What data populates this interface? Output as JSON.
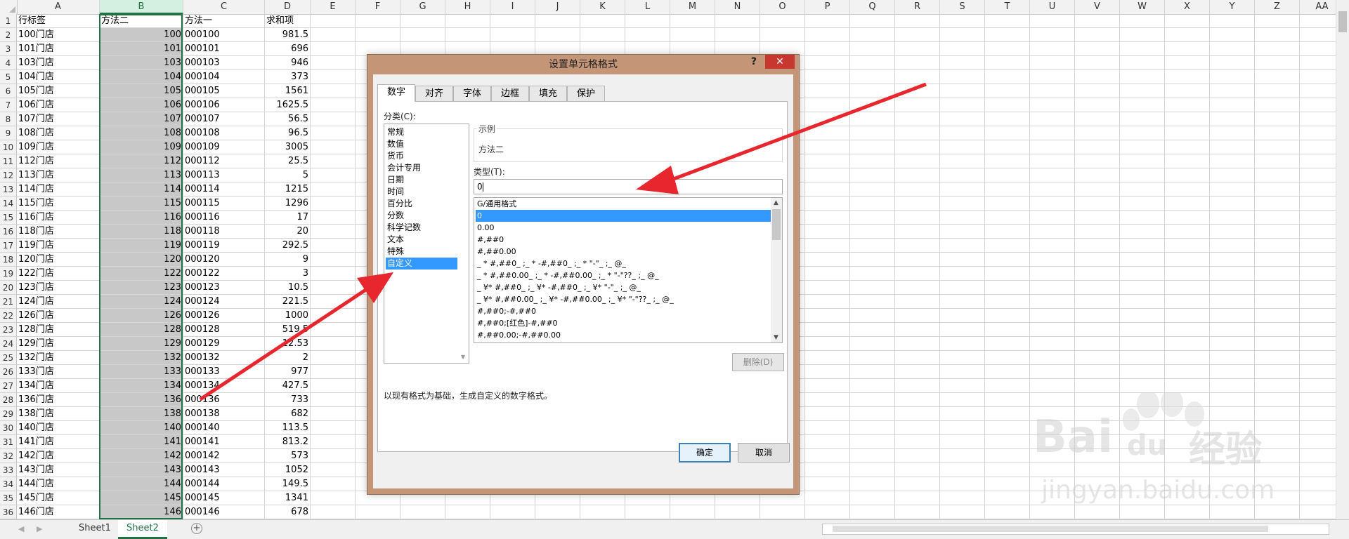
{
  "columns": [
    "A",
    "B",
    "C",
    "D",
    "E",
    "F",
    "G",
    "H",
    "I",
    "J",
    "K",
    "L",
    "M",
    "N",
    "O",
    "P",
    "Q",
    "R",
    "S",
    "T",
    "U",
    "V",
    "W",
    "X",
    "Y",
    "Z",
    "AA"
  ],
  "header_row": [
    "行标签",
    "方法二",
    "方法一",
    "求和项"
  ],
  "rows": [
    [
      "100门店",
      "100",
      "000100",
      "981.5"
    ],
    [
      "101门店",
      "101",
      "000101",
      "696"
    ],
    [
      "103门店",
      "103",
      "000103",
      "946"
    ],
    [
      "104门店",
      "104",
      "000104",
      "373"
    ],
    [
      "105门店",
      "105",
      "000105",
      "1561"
    ],
    [
      "106门店",
      "106",
      "000106",
      "1625.5"
    ],
    [
      "107门店",
      "107",
      "000107",
      "56.5"
    ],
    [
      "108门店",
      "108",
      "000108",
      "96.5"
    ],
    [
      "109门店",
      "109",
      "000109",
      "3005"
    ],
    [
      "112门店",
      "112",
      "000112",
      "25.5"
    ],
    [
      "113门店",
      "113",
      "000113",
      "5"
    ],
    [
      "114门店",
      "114",
      "000114",
      "1215"
    ],
    [
      "115门店",
      "115",
      "000115",
      "1296"
    ],
    [
      "116门店",
      "116",
      "000116",
      "17"
    ],
    [
      "118门店",
      "118",
      "000118",
      "20"
    ],
    [
      "119门店",
      "119",
      "000119",
      "292.5"
    ],
    [
      "120门店",
      "120",
      "000120",
      "9"
    ],
    [
      "122门店",
      "122",
      "000122",
      "3"
    ],
    [
      "123门店",
      "123",
      "000123",
      "10.5"
    ],
    [
      "124门店",
      "124",
      "000124",
      "221.5"
    ],
    [
      "126门店",
      "126",
      "000126",
      "1000"
    ],
    [
      "128门店",
      "128",
      "000128",
      "519.5"
    ],
    [
      "129门店",
      "129",
      "000129",
      "12.53"
    ],
    [
      "132门店",
      "132",
      "000132",
      "2"
    ],
    [
      "133门店",
      "133",
      "000133",
      "977"
    ],
    [
      "134门店",
      "134",
      "000134",
      "427.5"
    ],
    [
      "136门店",
      "136",
      "000136",
      "733"
    ],
    [
      "138门店",
      "138",
      "000138",
      "682"
    ],
    [
      "140门店",
      "140",
      "000140",
      "113.5"
    ],
    [
      "141门店",
      "141",
      "000141",
      "813.2"
    ],
    [
      "142门店",
      "142",
      "000142",
      "573"
    ],
    [
      "143门店",
      "143",
      "000143",
      "1052"
    ],
    [
      "144门店",
      "144",
      "000144",
      "149.5"
    ],
    [
      "145门店",
      "145",
      "000145",
      "1341"
    ],
    [
      "146门店",
      "146",
      "000146",
      "678"
    ]
  ],
  "sheet_tabs": {
    "tab1": "Sheet1",
    "tab2": "Sheet2"
  },
  "dialog": {
    "title": "设置单元格格式",
    "help": "?",
    "close": "✕",
    "tabs": [
      "数字",
      "对齐",
      "字体",
      "边框",
      "填充",
      "保护"
    ],
    "category_label": "分类(C):",
    "categories": [
      "常规",
      "数值",
      "货币",
      "会计专用",
      "日期",
      "时间",
      "百分比",
      "分数",
      "科学记数",
      "文本",
      "特殊",
      "自定义"
    ],
    "selected_category": 11,
    "sample_label": "示例",
    "sample_value": "方法二",
    "type_label": "类型(T):",
    "type_value": "0",
    "formats": [
      "G/通用格式",
      "0",
      "0.00",
      "#,##0",
      "#,##0.00",
      "_ * #,##0_ ;_ * -#,##0_ ;_ * \"-\"_ ;_ @_",
      "_ * #,##0.00_ ;_ * -#,##0.00_ ;_ * \"-\"??_ ;_ @_",
      "_ ¥* #,##0_ ;_ ¥* -#,##0_ ;_ ¥* \"-\"_ ;_ @_",
      "_ ¥* #,##0.00_ ;_ ¥* -#,##0.00_ ;_ ¥* \"-\"??_ ;_ @_",
      "#,##0;-#,##0",
      "#,##0;[红色]-#,##0",
      "#,##0.00;-#,##0.00"
    ],
    "selected_format": 1,
    "delete_label": "删除(D)",
    "description": "以现有格式为基础，生成自定义的数字格式。",
    "ok_label": "确定",
    "cancel_label": "取消"
  },
  "watermark": {
    "brand": "Bai",
    "du": "du",
    "jingyan": "经验",
    "url": "jingyan.baidu.com"
  },
  "colors": {
    "accent": "#217346",
    "arrow": "#e8262d",
    "selection": "#3399ff",
    "dialog_frame": "#c59577"
  }
}
